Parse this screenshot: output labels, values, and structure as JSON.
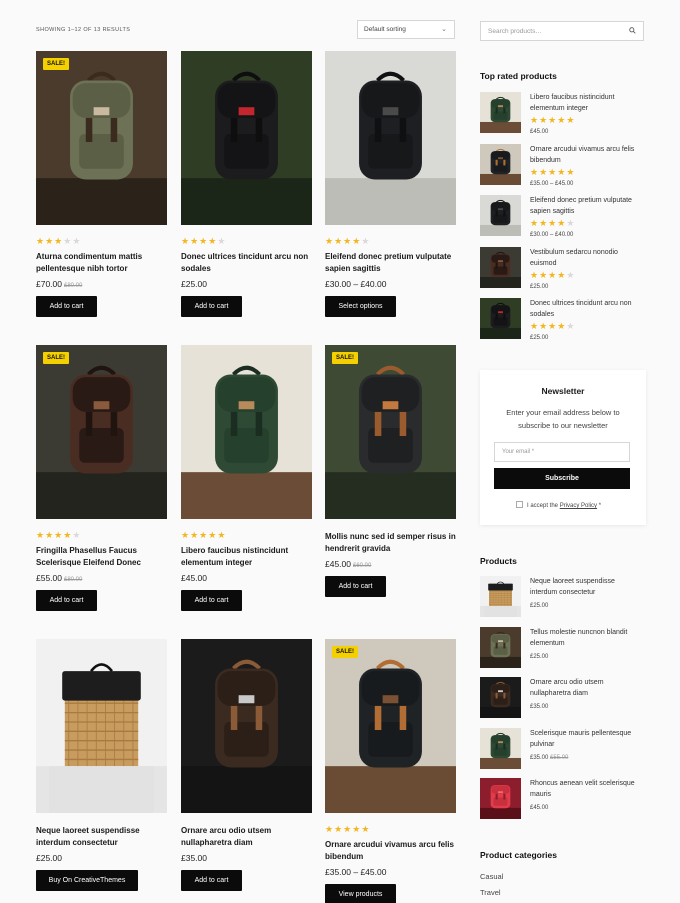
{
  "shop": {
    "result_count": "SHOWING 1–12 OF 13 RESULTS",
    "sort_value": "Default sorting"
  },
  "products": [
    {
      "title": "Aturna condimentum mattis pellentesque nibh tortor",
      "price": "£70.00",
      "old_price": "£80.00",
      "sale": "SALE!",
      "rating": 3,
      "button": "Add to cart"
    },
    {
      "title": "Donec ultrices tincidunt arcu non sodales",
      "price": "£25.00",
      "old_price": "",
      "sale": "",
      "rating": 4,
      "button": "Add to cart"
    },
    {
      "title": "Eleifend donec pretium vulputate sapien sagittis",
      "price": "£30.00 – £40.00",
      "old_price": "",
      "sale": "",
      "rating": 4,
      "button": "Select options"
    },
    {
      "title": "Fringilla Phasellus Faucus Scelerisque Eleifend Donec",
      "price": "£55.00",
      "old_price": "£80.00",
      "sale": "SALE!",
      "rating": 4,
      "button": "Add to cart"
    },
    {
      "title": "Libero faucibus nistincidunt elementum integer",
      "price": "£45.00",
      "old_price": "",
      "sale": "",
      "rating": 5,
      "button": "Add to cart"
    },
    {
      "title": "Mollis nunc sed id semper risus in hendrerit gravida",
      "price": "£45.00",
      "old_price": "£60.00",
      "sale": "SALE!",
      "rating": 0,
      "button": "Add to cart"
    },
    {
      "title": "Neque laoreet suspendisse interdum consectetur",
      "price": "£25.00",
      "old_price": "",
      "sale": "",
      "rating": 0,
      "button": "Buy On CreativeThemes"
    },
    {
      "title": "Ornare arcu odio utsem nullapharetra diam",
      "price": "£35.00",
      "old_price": "",
      "sale": "",
      "rating": 0,
      "button": "Add to cart"
    },
    {
      "title": "Ornare arcudui vivamus arcu felis bibendum",
      "price": "£35.00 – £45.00",
      "old_price": "",
      "sale": "SALE!",
      "rating": 5,
      "button": "View products"
    }
  ],
  "sidebar": {
    "search_placeholder": "Search products…",
    "top_rated_title": "Top rated products",
    "top_rated": [
      {
        "name": "Libero faucibus nistincidunt elementum integer",
        "price": "£45.00",
        "old_price": "",
        "rating": 5
      },
      {
        "name": "Ornare arcudui vivamus arcu felis bibendum",
        "price": "£35.00 – £45.00",
        "old_price": "",
        "rating": 5
      },
      {
        "name": "Eleifend donec pretium vulputate sapien sagittis",
        "price": "£30.00 – £40.00",
        "old_price": "",
        "rating": 4
      },
      {
        "name": "Vestibulum sedarcu nonodio euismod",
        "price": "£25.00",
        "old_price": "",
        "rating": 4
      },
      {
        "name": "Donec ultrices tincidunt arcu non sodales",
        "price": "£25.00",
        "old_price": "",
        "rating": 4
      }
    ],
    "newsletter": {
      "title": "Newsletter",
      "description": "Enter your email address below to subscribe to our newsletter",
      "placeholder": "Your email *",
      "button": "Subscribe",
      "consent_prefix": "I accept the",
      "consent_link": "Privacy Policy",
      "consent_required": "*"
    },
    "products_title": "Products",
    "products": [
      {
        "name": "Neque laoreet suspendisse interdum consectetur",
        "price": "£25.00",
        "old_price": ""
      },
      {
        "name": "Tellus molestie nuncnon blandit elementum",
        "price": "£25.00",
        "old_price": ""
      },
      {
        "name": "Ornare arcu odio utsem nullapharetra diam",
        "price": "£35.00",
        "old_price": ""
      },
      {
        "name": "Scelerisque mauris pellentesque pulvinar",
        "price": "£35.00",
        "old_price": "£55.00"
      },
      {
        "name": "Rhoncus aenean velit scelerisque mauris",
        "price": "£45.00",
        "old_price": ""
      }
    ],
    "categories_title": "Product categories",
    "categories": [
      "Casual",
      "Travel"
    ]
  }
}
